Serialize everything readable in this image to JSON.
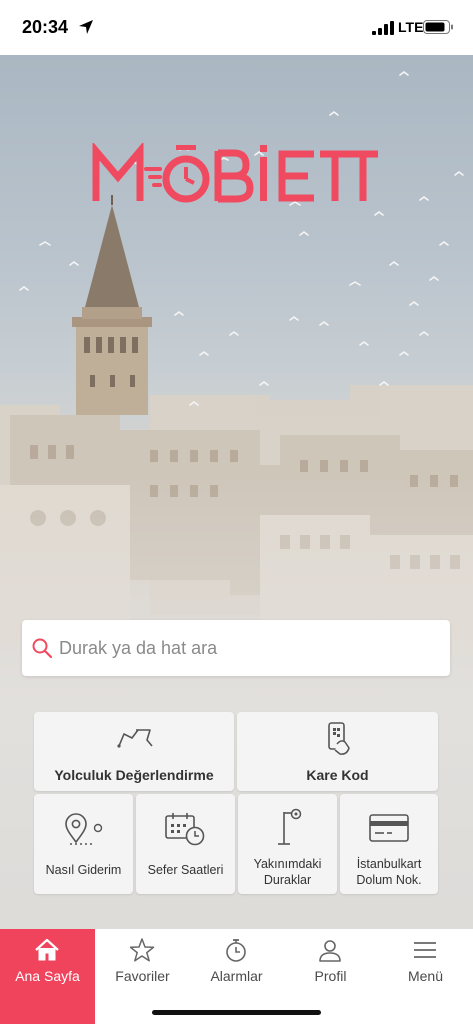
{
  "status_bar": {
    "time": "20:34",
    "network": "LTE"
  },
  "brand": {
    "name": "MOBIETT",
    "color": "#ef4a5f"
  },
  "search": {
    "placeholder": "Durak ya da hat ara"
  },
  "tiles": {
    "trip_rating": {
      "label": "Yolculuk Değerlendirme",
      "icon": "route-icon"
    },
    "qr_code": {
      "label": "Kare Kod",
      "icon": "phone-qr-icon"
    },
    "directions": {
      "label": "Nasıl Giderim",
      "icon": "location-pin-icon"
    },
    "schedules": {
      "label": "Sefer Saatleri",
      "icon": "calendar-clock-icon"
    },
    "nearby": {
      "line1": "Yakınımdaki",
      "line2": "Duraklar",
      "icon": "bus-stop-icon"
    },
    "card_topup": {
      "line1": "İstanbulkart",
      "line2": "Dolum Nok.",
      "icon": "card-icon"
    }
  },
  "nav": {
    "items": [
      {
        "label": "Ana Sayfa",
        "icon": "home-icon",
        "active": true
      },
      {
        "label": "Favoriler",
        "icon": "star-icon",
        "active": false
      },
      {
        "label": "Alarmlar",
        "icon": "stopwatch-icon",
        "active": false
      },
      {
        "label": "Profil",
        "icon": "user-icon",
        "active": false
      },
      {
        "label": "Menü",
        "icon": "menu-icon",
        "active": false
      }
    ],
    "active_color": "#f0445d"
  }
}
